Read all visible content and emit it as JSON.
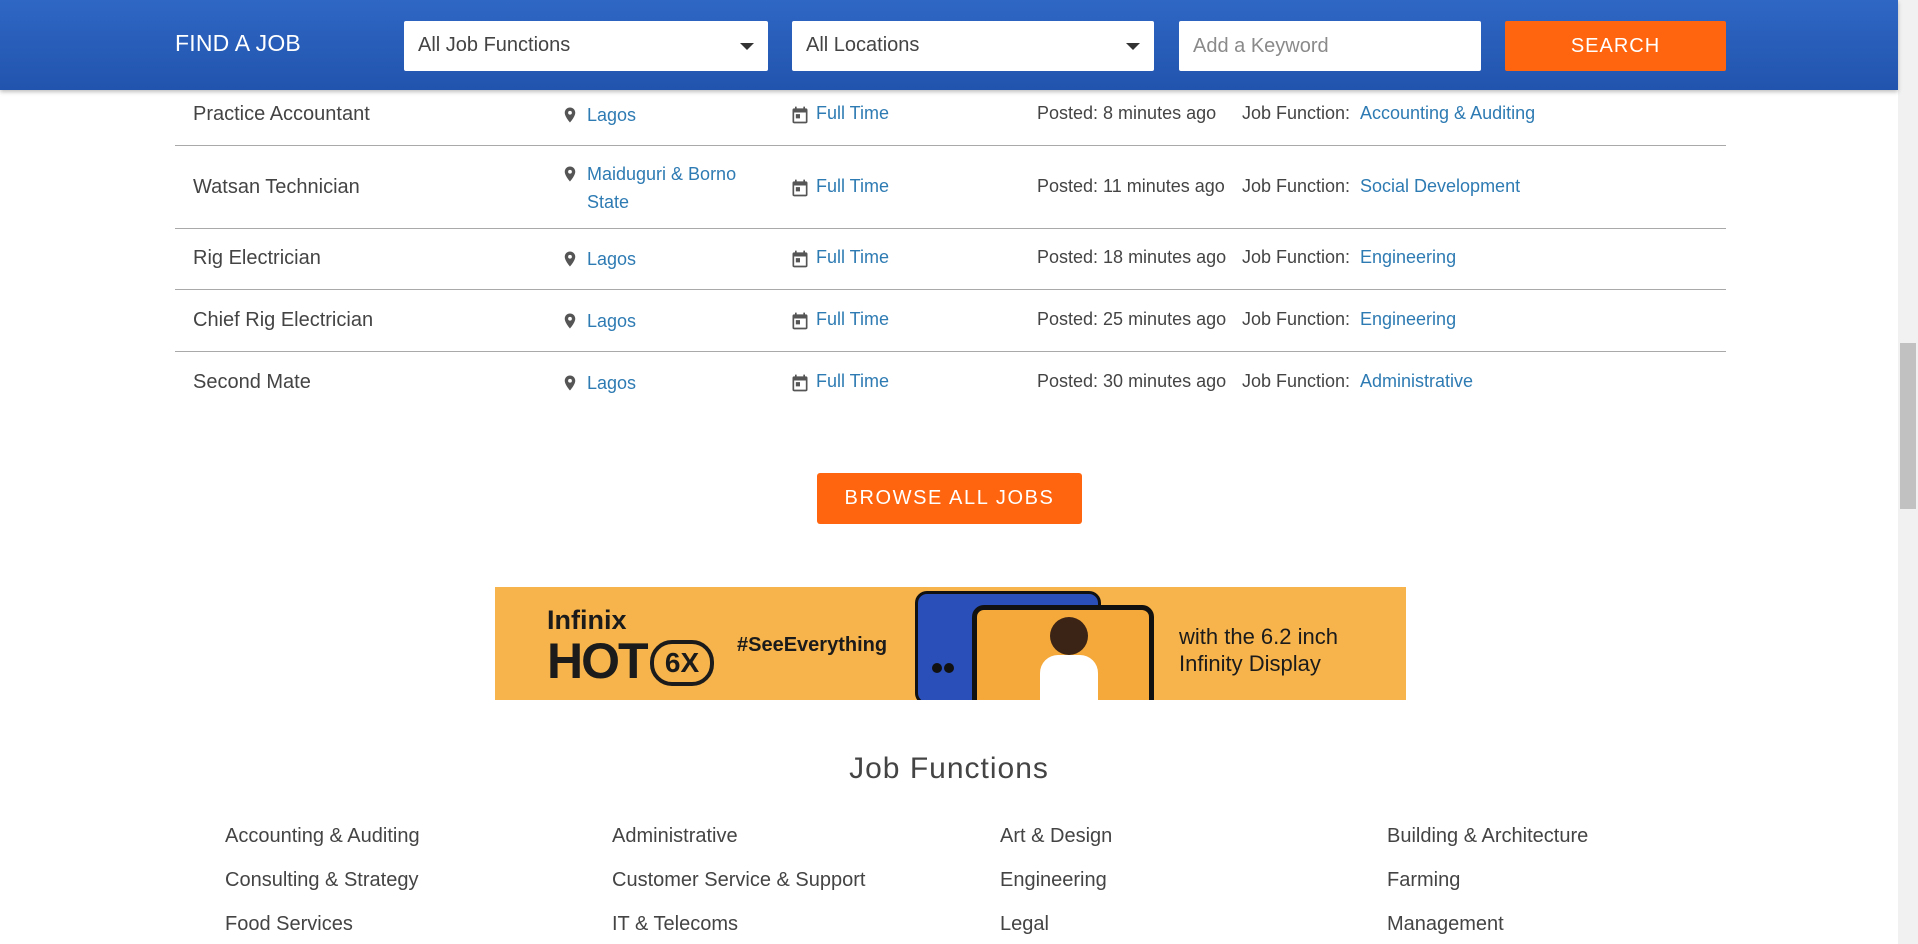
{
  "header": {
    "brand": "FIND A JOB",
    "function_select": "All Job Functions",
    "location_select": "All Locations",
    "keyword_placeholder": "Add a Keyword",
    "search_label": "SEARCH"
  },
  "jobs": [
    {
      "title": "Practice Accountant",
      "location": "Lagos",
      "type": "Full Time",
      "posted": "Posted: 8 minutes ago",
      "function_label": "Job Function:",
      "function": "Accounting & Auditing"
    },
    {
      "title": "Watsan Technician",
      "location": "Maiduguri & Borno State",
      "type": "Full Time",
      "posted": "Posted: 11 minutes ago",
      "function_label": "Job Function:",
      "function": "Social Development"
    },
    {
      "title": "Rig Electrician",
      "location": "Lagos",
      "type": "Full Time",
      "posted": "Posted: 18 minutes ago",
      "function_label": "Job Function:",
      "function": "Engineering"
    },
    {
      "title": "Chief Rig Electrician",
      "location": "Lagos",
      "type": "Full Time",
      "posted": "Posted: 25 minutes ago",
      "function_label": "Job Function:",
      "function": "Engineering"
    },
    {
      "title": "Second Mate",
      "location": "Lagos",
      "type": "Full Time",
      "posted": "Posted: 30 minutes ago",
      "function_label": "Job Function:",
      "function": "Administrative"
    }
  ],
  "browse_label": "BROWSE ALL JOBS",
  "banner": {
    "brand": "Infinix",
    "model": "HOT",
    "model_badge": "6X",
    "hashtag": "#SeeEverything",
    "tagline_1": "with the 6.2 inch",
    "tagline_2": "Infinity Display"
  },
  "job_functions": {
    "title": "Job Functions",
    "items": [
      "Accounting & Auditing",
      "Administrative",
      "Art & Design",
      "Building & Architecture",
      "Consulting & Strategy",
      "Customer Service & Support",
      "Engineering",
      "Farming",
      "Food Services",
      "IT & Telecoms",
      "Legal",
      "Management"
    ]
  },
  "colors": {
    "header_blue": "#2a5fbf",
    "accent_orange": "#ff650e",
    "link_blue": "#2e7bb3",
    "banner_orange": "#f7b44c"
  },
  "icons": {
    "location": "map-pin-icon",
    "job_type": "calendar-icon",
    "dropdown": "caret-down-icon"
  }
}
